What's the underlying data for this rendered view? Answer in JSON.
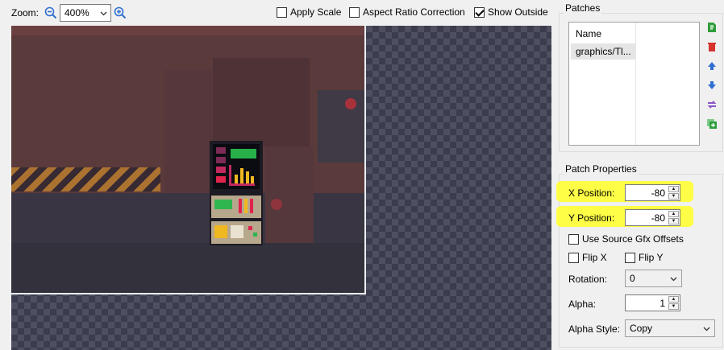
{
  "toolbar": {
    "zoom_label": "Zoom:",
    "zoom_value": "400%",
    "zoom_out_icon": "zoom-out-icon",
    "zoom_in_icon": "zoom-in-icon",
    "apply_scale": {
      "label": "Apply Scale",
      "checked": false
    },
    "aspect_ratio": {
      "label": "Aspect Ratio Correction",
      "checked": false
    },
    "show_outside": {
      "label": "Show Outside",
      "checked": true
    }
  },
  "patches": {
    "title": "Patches",
    "column_header": "Name",
    "items": [
      "graphics/Tl..."
    ],
    "buttons": [
      {
        "name": "new-patch-icon",
        "color": "#2e9e3a"
      },
      {
        "name": "delete-patch-icon",
        "color": "#d6322e"
      },
      {
        "name": "move-up-icon",
        "color": "#2f6fd1"
      },
      {
        "name": "move-down-icon",
        "color": "#2f6fd1"
      },
      {
        "name": "swap-patches-icon",
        "color": "#8a55c9"
      },
      {
        "name": "duplicate-patch-icon",
        "color": "#2e9e3a"
      }
    ]
  },
  "properties": {
    "title": "Patch Properties",
    "x_label": "X Position:",
    "x_value": "-80",
    "y_label": "Y Position:",
    "y_value": "-80",
    "use_source_offsets": {
      "label": "Use Source Gfx Offsets",
      "checked": false
    },
    "flip_x": {
      "label": "Flip X",
      "checked": false
    },
    "flip_y": {
      "label": "Flip Y",
      "checked": false
    },
    "rotation_label": "Rotation:",
    "rotation_value": "0",
    "alpha_label": "Alpha:",
    "alpha_value": "1",
    "alpha_style_label": "Alpha Style:",
    "alpha_style_value": "Copy"
  },
  "colors": {
    "highlight": "#ffff33",
    "canvas_checker": "#4e5062"
  }
}
